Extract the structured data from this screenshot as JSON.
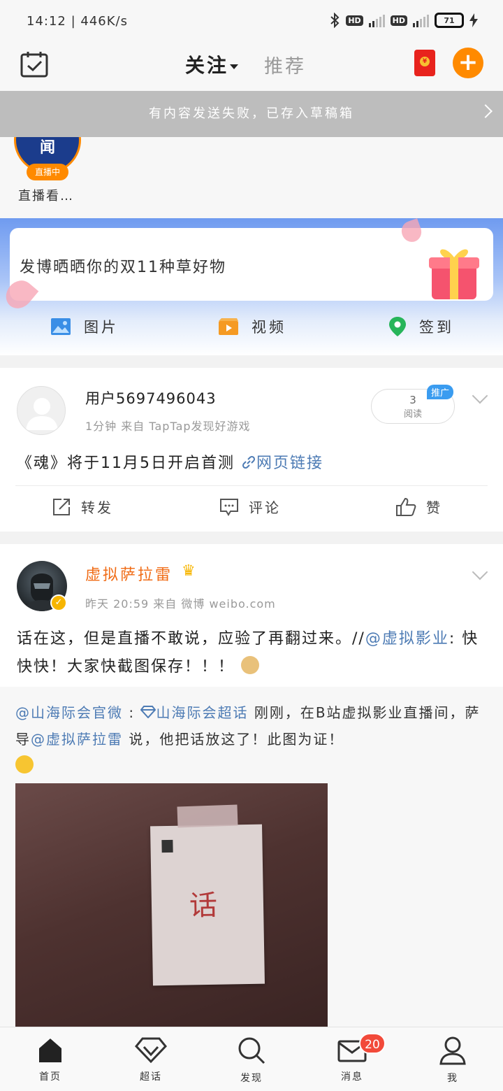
{
  "status_bar": {
    "time": "14:12",
    "speed": "446K/s",
    "battery": "71"
  },
  "top_nav": {
    "tab_follow": "关注",
    "tab_recommend": "推荐"
  },
  "draft_banner": "有内容发送失败，已存入草稿箱",
  "live": {
    "avatar_text": "央视新闻",
    "live_tag": "直播中",
    "label": "直播看…"
  },
  "compose": {
    "prompt": "发博晒晒你的双11种草好物",
    "actions": [
      {
        "label": "图片",
        "icon": "image-icon"
      },
      {
        "label": "视频",
        "icon": "video-icon"
      },
      {
        "label": "签到",
        "icon": "location-pin-icon"
      }
    ]
  },
  "post1": {
    "username": "用户5697496043",
    "time": "1分钟",
    "source": "来自 TapTap发现好游戏",
    "read_count": "3",
    "read_label": "阅读",
    "promo_tag": "推广",
    "content": "《魂》将于11月5日开启首测",
    "link_text": "网页链接",
    "actions": {
      "repost": "转发",
      "comment": "评论",
      "like": "赞"
    }
  },
  "post2": {
    "username": "虚拟萨拉雷",
    "time": "昨天 20:59",
    "source": "来自 微博 weibo.com",
    "content_text": "话在这，但是直播不敢说，应验了再翻过来。//",
    "content_mention": "@虚拟影业",
    "content_tail": ": 快快快！大家快截图保存！！！",
    "repost_mention1": "@山海际会官微",
    "repost_colon": " :",
    "repost_topic": "山海际会超话",
    "repost_text1": "  刚刚，在B站虚拟影业直播间，萨导",
    "repost_mention2": "@虚拟萨拉雷",
    "repost_text2": " 说，他把话放这了！此图为证！",
    "photo_text": "话"
  },
  "bottom_nav": {
    "items": [
      {
        "label": "首页",
        "icon": "home-icon"
      },
      {
        "label": "超话",
        "icon": "diamond-icon"
      },
      {
        "label": "发现",
        "icon": "search-icon"
      },
      {
        "label": "消息",
        "icon": "mail-icon"
      },
      {
        "label": "我",
        "icon": "user-icon"
      }
    ],
    "message_badge": "20"
  },
  "colors": {
    "accent": "#ff8a00",
    "link": "#4d7bb4",
    "username_highlight": "#f06b15"
  }
}
